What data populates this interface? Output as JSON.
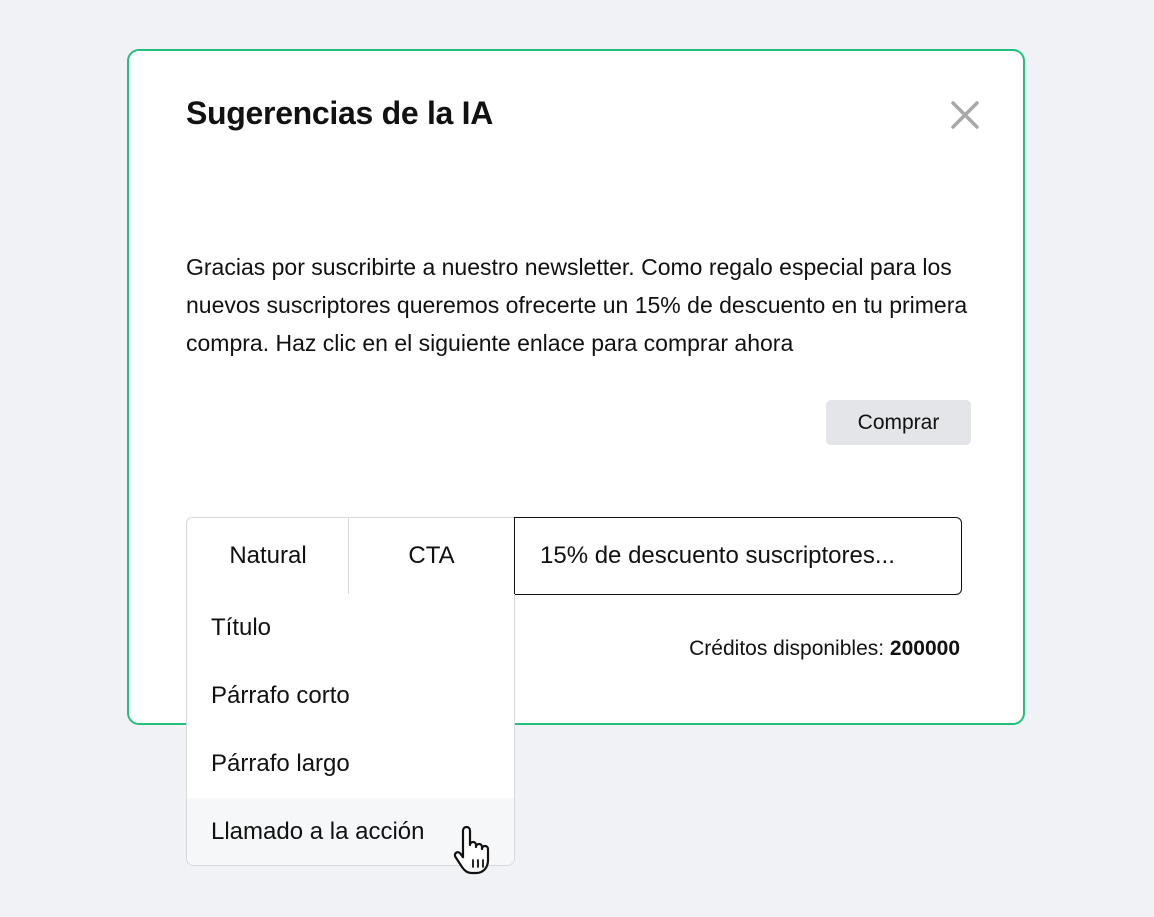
{
  "modal": {
    "title": "Sugerencias de la IA",
    "close_icon": "close-icon",
    "body_text": "Gracias por suscribirte a nuestro newsletter. Como regalo especial para los nuevos suscriptores queremos ofrecerte un 15% de descuento en tu primera compra. Haz clic en el siguiente enlace para comprar ahora",
    "buy_button_label": "Comprar"
  },
  "controls": {
    "tone": "Natural",
    "format": "CTA",
    "prompt_value": "15% de descuento suscriptores..."
  },
  "credits": {
    "label": "Créditos disponibles:",
    "value": "200000"
  },
  "dropdown": {
    "items": [
      {
        "label": "Título"
      },
      {
        "label": "Párrafo corto"
      },
      {
        "label": "Párrafo largo"
      },
      {
        "label": "Llamado a la acción"
      }
    ],
    "hovered_index": 3
  },
  "colors": {
    "page_background": "#f0f2f5",
    "modal_border": "#22c07a",
    "button_background": "#e3e5e8",
    "close_icon": "#a8a8a8"
  },
  "pointer_icon": "hand-pointer-icon"
}
